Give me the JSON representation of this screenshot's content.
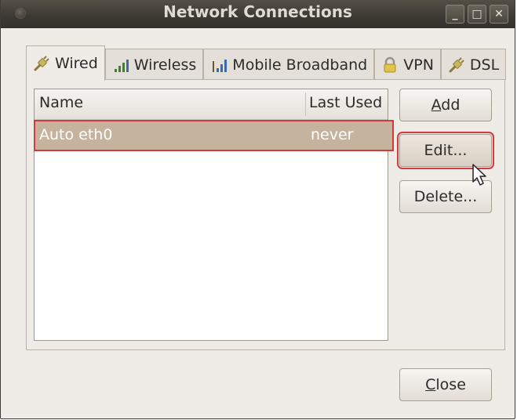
{
  "window": {
    "title": "Network Connections",
    "controls": {
      "minimize": "_",
      "maximize": "□",
      "close": "✕"
    }
  },
  "tabs": [
    {
      "label": "Wired",
      "icon": "wired-plug-icon",
      "active": true
    },
    {
      "label": "Wireless",
      "icon": "wireless-signal-icon",
      "active": false
    },
    {
      "label": "Mobile Broadband",
      "icon": "mobile-signal-icon",
      "active": false
    },
    {
      "label": "VPN",
      "icon": "padlock-icon",
      "active": false
    },
    {
      "label": "DSL",
      "icon": "dsl-plug-icon",
      "active": false
    }
  ],
  "connections": {
    "columns": {
      "name": "Name",
      "last_used": "Last Used"
    },
    "rows": [
      {
        "name": "Auto eth0",
        "last_used": "never",
        "selected": true
      }
    ]
  },
  "buttons": {
    "add": "Add",
    "edit": "Edit...",
    "delete": "Delete...",
    "close": "Close"
  },
  "colors": {
    "titlebar": "#3c3933",
    "window_bg": "#efebe7",
    "selection": "#c6b39e",
    "highlight_outline": "#d23b3b"
  }
}
